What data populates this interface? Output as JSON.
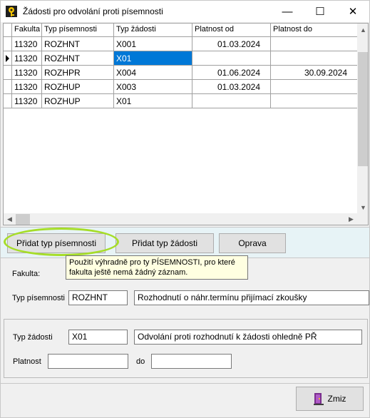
{
  "window": {
    "title": "Žádosti pro odvolání proti písemnosti",
    "controls": {
      "minimize": "—",
      "maximize": "☐",
      "close": "✕"
    },
    "app_icon": "key-icon"
  },
  "grid": {
    "columns": [
      "Fakulta",
      "Typ písemnosti",
      "Typ žádosti",
      "Platnost od",
      "Platnost do"
    ],
    "rows": [
      {
        "fakulta": "11320",
        "typ_pisemnosti": "ROZHNT",
        "typ_zadosti": "X001",
        "platnost_od": "01.03.2024",
        "platnost_do": ""
      },
      {
        "fakulta": "11320",
        "typ_pisemnosti": "ROZHNT",
        "typ_zadosti": "X01",
        "platnost_od": "",
        "platnost_do": ""
      },
      {
        "fakulta": "11320",
        "typ_pisemnosti": "ROZHPR",
        "typ_zadosti": "X004",
        "platnost_od": "01.06.2024",
        "platnost_do": "30.09.2024"
      },
      {
        "fakulta": "11320",
        "typ_pisemnosti": "ROZHUP",
        "typ_zadosti": "X003",
        "platnost_od": "01.03.2024",
        "platnost_do": ""
      },
      {
        "fakulta": "11320",
        "typ_pisemnosti": "ROZHUP",
        "typ_zadosti": "X01",
        "platnost_od": "",
        "platnost_do": ""
      }
    ],
    "current_row": 1,
    "selected_color": "#0078d7"
  },
  "buttons": {
    "add_document_type": "Přidat typ písemnosti",
    "add_request_type": "Přidat typ žádosti",
    "repair": "Oprava",
    "exit": "Zmiz"
  },
  "tooltip": {
    "text_line1": "Použití výhradně pro ty PÍSEMNOSTI, pro které",
    "text_line2": "fakulta ještě nemá žádný záznam."
  },
  "form": {
    "fakulta_label": "Fakulta:",
    "typ_pisemnosti_label": "Typ písemnosti",
    "typ_pisemnosti_code": "ROZHNT",
    "typ_pisemnosti_desc": "Rozhodnutí o náhr.termínu přijímací zkoušky",
    "typ_zadosti_label": "Typ žádosti",
    "typ_zadosti_code": "X01",
    "typ_zadosti_desc": "Odvolání proti rozhodnutí k žádosti ohledně PŘ",
    "platnost_label": "Platnost",
    "platnost_od": "",
    "do_label": "do",
    "platnost_do": ""
  },
  "colors": {
    "toolbar_bg": "#e7f3f6",
    "highlight": "#a6dd28",
    "tooltip_bg": "#ffffe1"
  }
}
